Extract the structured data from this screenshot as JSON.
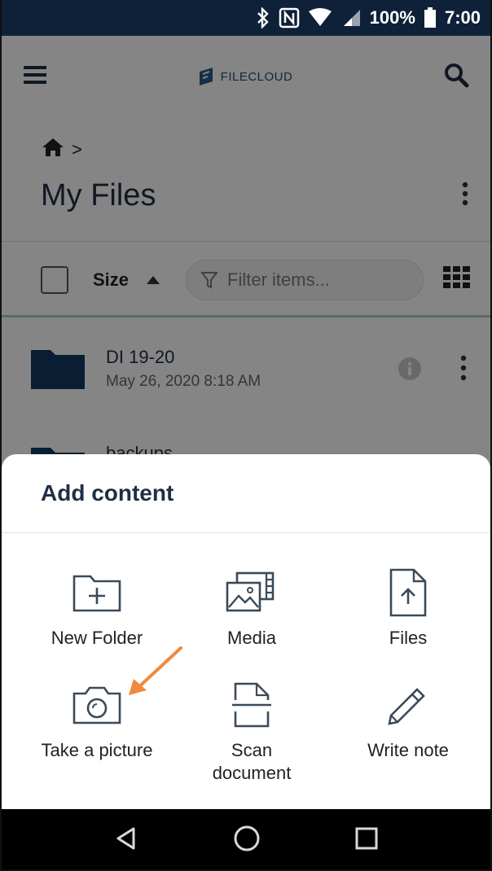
{
  "status_bar": {
    "battery": "100%",
    "time": "7:00",
    "icons": [
      "bluetooth-icon",
      "nfc-icon",
      "wifi-icon",
      "signal-icon",
      "battery-icon"
    ]
  },
  "app_bar": {
    "brand": "FILECLOUD",
    "menu_icon": "hamburger-menu-icon",
    "search_icon": "search-icon"
  },
  "breadcrumb": {
    "home_icon": "home-icon",
    "separator": ">"
  },
  "page": {
    "title": "My Files"
  },
  "toolbar": {
    "sort_label": "Size",
    "filter_placeholder": "Filter items..."
  },
  "files": [
    {
      "name": "DI 19-20",
      "date": "May 26, 2020 8:18 AM"
    },
    {
      "name": "backups"
    }
  ],
  "sheet": {
    "title": "Add content",
    "options": [
      {
        "label": "New Folder",
        "icon": "new-folder-icon"
      },
      {
        "label": "Media",
        "icon": "media-icon"
      },
      {
        "label": "Files",
        "icon": "file-upload-icon"
      },
      {
        "label": "Take a picture",
        "icon": "camera-icon"
      },
      {
        "label_line1": "Scan",
        "label_line2": "document",
        "icon": "scan-document-icon"
      },
      {
        "label": "Write note",
        "icon": "pencil-icon"
      }
    ]
  },
  "colors": {
    "status_bar": "#0f2139",
    "primary_text": "#1f2f44",
    "folder": "#123a62",
    "annotation_arrow": "#f08a3c"
  }
}
